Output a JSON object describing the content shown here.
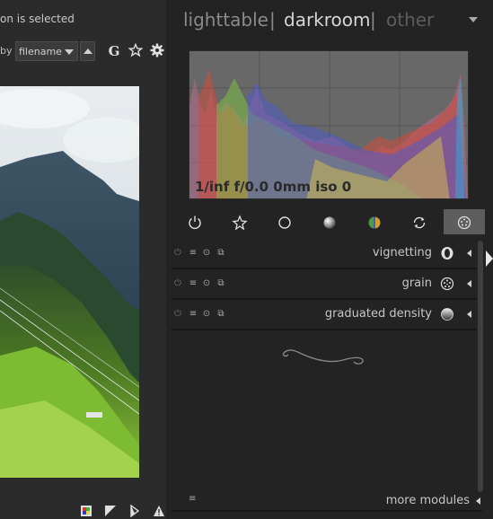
{
  "left_panel": {
    "selection_status": "on is selected",
    "sort": {
      "label": "by",
      "value": "filename"
    },
    "header_icons": [
      "grouping-icon",
      "star-icon",
      "gear-icon"
    ],
    "group_letter": "G",
    "bottom_icons": [
      "color-assessment-icon",
      "overexposed-icon",
      "softproof-icon",
      "gamut-check-icon"
    ]
  },
  "view_switcher": {
    "lighttable": "lighttable",
    "separator": "|",
    "darkroom": "darkroom",
    "other": "other",
    "active": "darkroom"
  },
  "histogram": {
    "exif": "1/inf f/0.0 0mm iso 0"
  },
  "module_groups": {
    "tabs": [
      {
        "name": "active-modules-icon",
        "active": false
      },
      {
        "name": "favourites-icon",
        "active": false
      },
      {
        "name": "base-group-icon",
        "active": false
      },
      {
        "name": "tone-group-icon",
        "active": false
      },
      {
        "name": "color-group-icon",
        "active": false
      },
      {
        "name": "correct-group-icon",
        "active": false
      },
      {
        "name": "effect-group-icon",
        "active": true
      }
    ]
  },
  "modules": [
    {
      "name": "vignetting",
      "icon": "vignetting-icon"
    },
    {
      "name": "grain",
      "icon": "grain-icon"
    },
    {
      "name": "graduated density",
      "icon": "graduated-density-icon"
    }
  ],
  "module_controls": {
    "power": "⏻",
    "menu": "≡",
    "preset": "⊙",
    "copy": "⧉"
  },
  "more_modules": {
    "label": "more modules",
    "menu": "≡"
  },
  "colors": {
    "background": "#222322",
    "panel": "#2a2b2a",
    "histogram_bg": "#686868",
    "active_tab": "#5d5d5d",
    "text": "#c6c6c6",
    "view_active": "#d6d6d6",
    "view_inactive": "#8b8b8b"
  }
}
